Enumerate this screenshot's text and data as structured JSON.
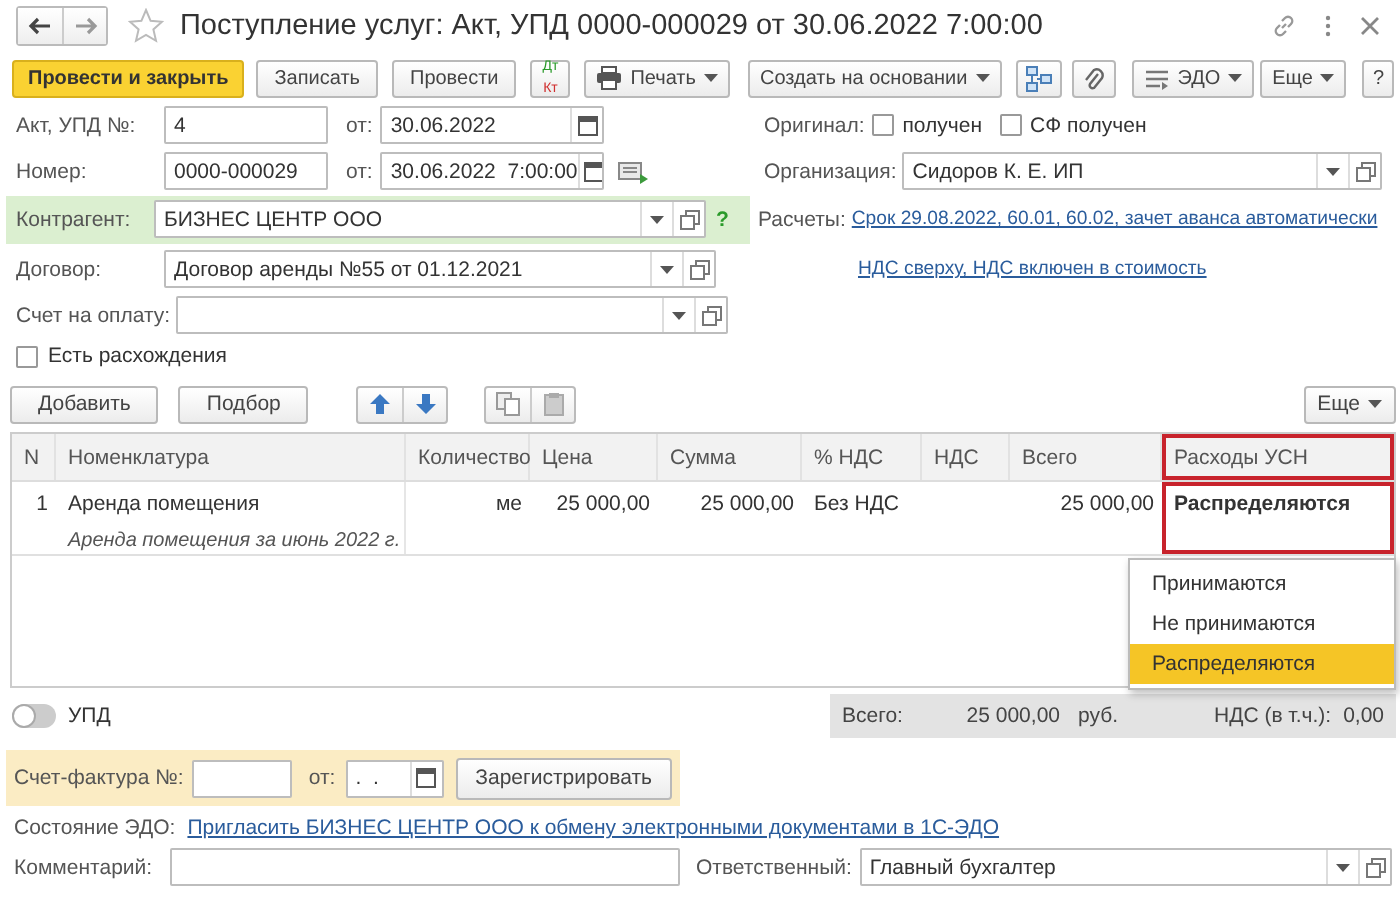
{
  "window": {
    "title": "Поступление услуг: Акт, УПД 0000-000029 от 30.06.2022 7:00:00",
    "favorite": false
  },
  "toolbar": {
    "buttons": [
      {
        "kind": "primary",
        "label": "Провести и закрыть"
      },
      {
        "kind": "plain",
        "label": "Записать"
      },
      {
        "kind": "plain",
        "label": "Провести"
      },
      {
        "kind": "dtkt",
        "label": "Дт",
        "sub": "Кт"
      },
      {
        "kind": "print",
        "label": "Печать"
      },
      {
        "kind": "menu",
        "label": "Создать на основании"
      },
      {
        "kind": "structure"
      },
      {
        "kind": "attach"
      },
      {
        "kind": "edo",
        "label": "ЭДО"
      }
    ],
    "right_buttons": [
      {
        "kind": "menu",
        "label": "Еще"
      },
      {
        "kind": "help",
        "label": "?"
      }
    ]
  },
  "header": {
    "act_number": {
      "label": "Акт, УПД №:",
      "value": "4"
    },
    "act_date": {
      "label": "от:",
      "value": "30.06.2022"
    },
    "number": {
      "label": "Номер:",
      "value": "0000-000029"
    },
    "number_date": {
      "label": "от:",
      "value": "30.06.2022  7:00:00"
    },
    "original": {
      "label": "Оригинал:",
      "checkboxes": [
        {
          "label": "получен",
          "checked": false
        },
        {
          "label": "СФ получен",
          "checked": false
        }
      ]
    },
    "organization": {
      "label": "Организация:",
      "value": "Сидоров К. Е. ИП"
    },
    "counterparty": {
      "label": "Контрагент:",
      "value": "БИЗНЕС ЦЕНТР ООО",
      "help": "?"
    },
    "settlements": {
      "label": "Расчеты:",
      "link": "Срок 29.08.2022, 60.01, 60.02, зачет аванса автоматически"
    },
    "contract": {
      "label": "Договор:",
      "value": "Договор аренды №55 от 01.12.2021"
    },
    "vat_link": "НДС сверху, НДС включен в стоимость",
    "invoice": {
      "label": "Счет на оплату:"
    },
    "discrepancies": {
      "label": "Есть расхождения",
      "checked": false
    }
  },
  "table": {
    "buttons": [
      {
        "kind": "text",
        "label": "Добавить"
      },
      {
        "kind": "text",
        "label": "Подбор"
      },
      {
        "kind": "up"
      },
      {
        "kind": "down"
      },
      {
        "kind": "copy"
      },
      {
        "kind": "paste"
      }
    ],
    "more": "Еще",
    "columns": [
      {
        "label": "N",
        "highlighted": false
      },
      {
        "label": "Номенклатура",
        "highlighted": false
      },
      {
        "label": "Количество",
        "highlighted": false
      },
      {
        "label": "Цена",
        "highlighted": false
      },
      {
        "label": "Сумма",
        "highlighted": false
      },
      {
        "label": "% НДС",
        "highlighted": false
      },
      {
        "label": "НДС",
        "highlighted": false
      },
      {
        "label": "Всего",
        "highlighted": false
      },
      {
        "label": "Расходы УСН",
        "highlighted": true
      }
    ],
    "rows": [
      {
        "n": "1",
        "item": "Аренда помещения",
        "content": "Аренда помещения за июнь 2022 г.",
        "quantity": "ме",
        "price": "25 000,00",
        "amount": "25 000,00",
        "vat_rate": "Без НДС",
        "total": "25 000,00",
        "usn_expenses": "Распределяются"
      }
    ],
    "dropdown": {
      "options": [
        {
          "label": "Принимаются",
          "selected": false
        },
        {
          "label": "Не принимаются",
          "selected": false
        },
        {
          "label": "Распределяются",
          "selected": true
        }
      ]
    }
  },
  "footer": {
    "upd_toggle": {
      "label": "УПД",
      "on": false
    },
    "totals": {
      "total_label": "Всего:",
      "total": "25 000,00",
      "currency": "руб.",
      "vat_label": "НДС (в т.ч.):",
      "vat": "0,00"
    },
    "invoice_received": {
      "label": "Счет-фактура №:",
      "date_label": "от:",
      "date_value": ".  .",
      "button": "Зарегистрировать"
    },
    "edo_status": {
      "label": "Состояние ЭДО:",
      "link": "Пригласить БИЗНЕС ЦЕНТР ООО к обмену электронными документами в 1С-ЭДО"
    },
    "comment": {
      "label": "Комментарий:"
    },
    "responsible": {
      "label": "Ответственный:",
      "value": "Главный бухгалтер"
    }
  }
}
